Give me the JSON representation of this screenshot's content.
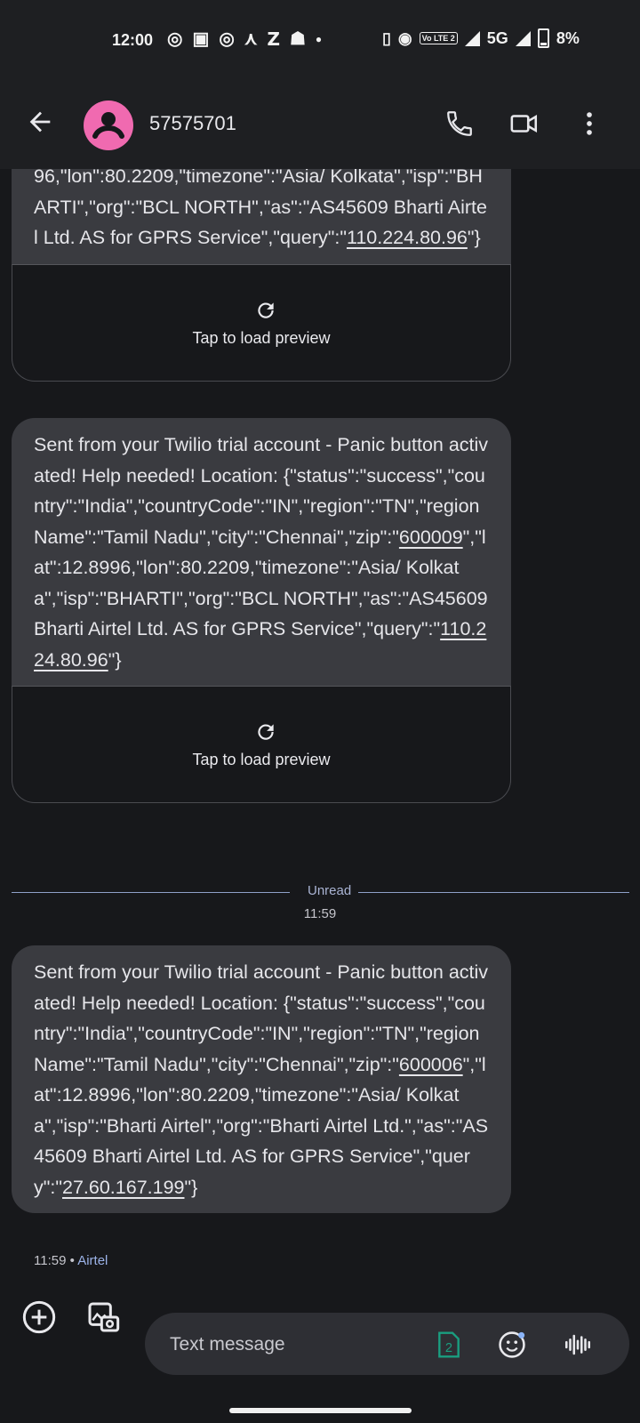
{
  "status_bar": {
    "time": "12:00",
    "notification_icons": [
      "instagram-icon",
      "teams-icon",
      "instagram-icon",
      "network-icon",
      "zomato-icon",
      "snapchat-icon",
      "dot-icon"
    ],
    "network_type": "5G",
    "volte_label": "Vo LTE 2",
    "battery_percent": "8%"
  },
  "header": {
    "title": "57575701",
    "avatar_color": "#f06ab0"
  },
  "messages": [
    {
      "prefix": "96,\"lon\":80.2209,\"timezone\":\"Asia/ Kolkata\",\"isp\":\"BHARTI\",\"org\":\"BCL NORTH\",\"as\":\"AS45609 Bharti Airtel Ltd. AS for GPRS Service\",\"query\":\"",
      "link": "110.224.80.96",
      "suffix": "\"}",
      "preview_label": "Tap to load preview"
    },
    {
      "prefix": "Sent from your Twilio trial account - Panic button activated! Help needed! Location: {\"status\":\"success\",\"country\":\"India\",\"countryCode\":\"IN\",\"region\":\"TN\",\"regionName\":\"Tamil Nadu\",\"city\":\"Chennai\",\"zip\":\"",
      "zip": "600009",
      "middle": "\",\"lat\":12.8996,\"lon\":80.2209,\"timezone\":\"Asia/ Kolkata\",\"isp\":\"BHARTI\",\"org\":\"BCL NORTH\",\"as\":\"AS45609 Bharti Airtel Ltd. AS for GPRS Service\",\"query\":\"",
      "link": "110.224.80.96",
      "suffix": "\"}",
      "preview_label": "Tap to load preview"
    },
    {
      "prefix": "Sent from your Twilio trial account - Panic button activated! Help needed! Location: {\"status\":\"success\",\"country\":\"India\",\"countryCode\":\"IN\",\"region\":\"TN\",\"regionName\":\"Tamil Nadu\",\"city\":\"Chennai\",\"zip\":\"",
      "zip": "600006",
      "middle": "\",\"lat\":12.8996,\"lon\":80.2209,\"timezone\":\"Asia/ Kolkata\",\"isp\":\"Bharti Airtel\",\"org\":\"Bharti Airtel Ltd.\",\"as\":\"AS45609 Bharti Airtel Ltd. AS for GPRS Service\",\"query\":\"",
      "link": "27.60.167.199",
      "suffix": "\"}",
      "time": "11:59",
      "separator": "•",
      "carrier": "Airtel"
    }
  ],
  "unread_divider": {
    "label": "Unread",
    "timestamp": "11:59"
  },
  "compose": {
    "placeholder": "Text message",
    "sim_label": "2"
  }
}
